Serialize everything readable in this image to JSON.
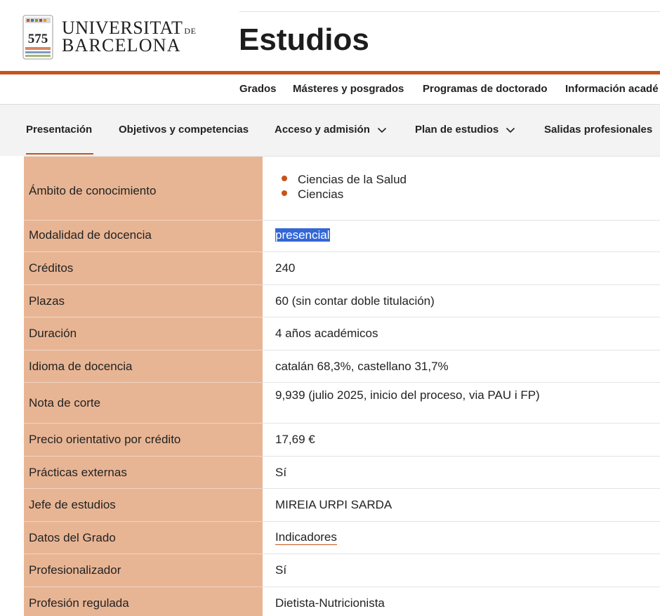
{
  "brand": {
    "university_line1": "UNIVERSITAT",
    "university_de": "DE",
    "university_line2": "BARCELONA",
    "logo_icon": "ub-575-seal-icon",
    "logo_text": "575",
    "accent_color": "#c7531c",
    "label_bg_color": "#e8b594"
  },
  "header": {
    "site_title": "Estudios"
  },
  "top_nav": {
    "items": [
      {
        "label": "Grados"
      },
      {
        "label": "Másteres y posgrados"
      },
      {
        "label": "Programas de doctorado"
      },
      {
        "label": "Información acadé"
      }
    ]
  },
  "tabs": {
    "items": [
      {
        "label": "Presentación",
        "active": true
      },
      {
        "label": "Objetivos y competencias",
        "active": false
      },
      {
        "label": "Acceso y admisión",
        "active": false,
        "icon": "chevron-down-icon"
      },
      {
        "label": "Plan de estudios",
        "active": false,
        "icon": "chevron-down-icon"
      },
      {
        "label": "Salidas profesionales",
        "active": false
      }
    ]
  },
  "info_table": {
    "rows": [
      {
        "label": "Ámbito de conocimiento",
        "values": [
          "Ciencias de la Salud",
          "Ciencias"
        ]
      },
      {
        "label": "Modalidad de docencia",
        "value": "presencial"
      },
      {
        "label": "Créditos",
        "value": "240"
      },
      {
        "label": "Plazas",
        "value": "60 (sin contar doble titulación)"
      },
      {
        "label": "Duración",
        "value": "4 años académicos"
      },
      {
        "label": "Idioma de docencia",
        "value": "catalán 68,3%, castellano 31,7%"
      },
      {
        "label": "Nota de corte",
        "value": "9,939  (julio 2025, inicio del proceso, via PAU i FP)"
      },
      {
        "label": "Precio orientativo por crédito",
        "value": "17,69 €"
      },
      {
        "label": "Prácticas externas",
        "value": "Sí"
      },
      {
        "label": "Jefe de estudios",
        "value": "MIREIA URPI SARDA"
      },
      {
        "label": "Datos del Grado",
        "value": "Indicadores"
      },
      {
        "label": "Profesionalizador",
        "value": "Sí"
      },
      {
        "label": "Profesión regulada",
        "value": "Dietista-Nutricionista"
      }
    ]
  }
}
